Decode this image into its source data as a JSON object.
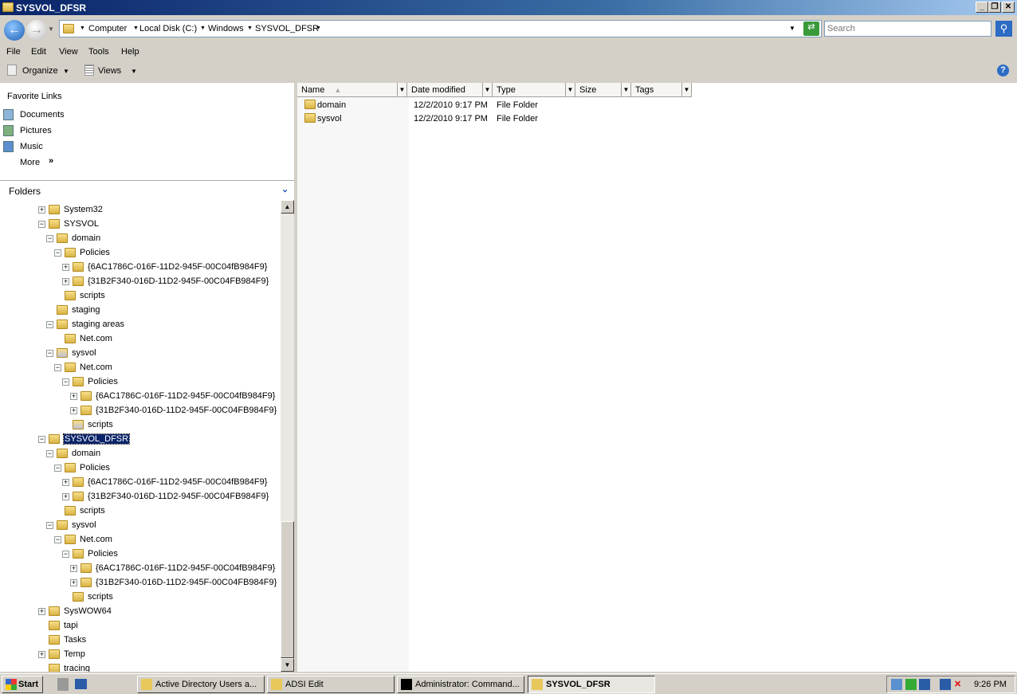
{
  "window": {
    "title": "SYSVOL_DFSR"
  },
  "address": {
    "crumbs": [
      "Computer",
      "Local Disk (C:)",
      "Windows",
      "SYSVOL_DFSR"
    ],
    "search_placeholder": "Search"
  },
  "menu": [
    "File",
    "Edit",
    "View",
    "Tools",
    "Help"
  ],
  "toolbar": {
    "organize": "Organize",
    "views": "Views"
  },
  "favorites": {
    "title": "Favorite Links",
    "items": [
      "Documents",
      "Pictures",
      "Music"
    ],
    "more": "More"
  },
  "folders": {
    "title": "Folders",
    "items": [
      {
        "label": "System32",
        "level": 0,
        "exp": "+"
      },
      {
        "label": "SYSVOL",
        "level": 0,
        "exp": "-"
      },
      {
        "label": "domain",
        "level": 1,
        "exp": "-"
      },
      {
        "label": "Policies",
        "level": 2,
        "exp": "-"
      },
      {
        "label": "{6AC1786C-016F-11D2-945F-00C04fB984F9}",
        "level": 3,
        "exp": "+"
      },
      {
        "label": "{31B2F340-016D-11D2-945F-00C04FB984F9}",
        "level": 3,
        "exp": "+"
      },
      {
        "label": "scripts",
        "level": 2,
        "exp": ""
      },
      {
        "label": "staging",
        "level": 1,
        "exp": ""
      },
      {
        "label": "staging areas",
        "level": 1,
        "exp": "-"
      },
      {
        "label": "Net.com",
        "level": 2,
        "exp": ""
      },
      {
        "label": "sysvol",
        "level": 1,
        "exp": "-",
        "shortcut": true
      },
      {
        "label": "Net.com",
        "level": 2,
        "exp": "-"
      },
      {
        "label": "Policies",
        "level": 3,
        "exp": "-"
      },
      {
        "label": "{6AC1786C-016F-11D2-945F-00C04fB984F9}",
        "level": 4,
        "exp": "+"
      },
      {
        "label": "{31B2F340-016D-11D2-945F-00C04FB984F9}",
        "level": 4,
        "exp": "+"
      },
      {
        "label": "scripts",
        "level": 3,
        "exp": "",
        "shortcut": true
      },
      {
        "label": "SYSVOL_DFSR",
        "level": 0,
        "exp": "-",
        "selected": true
      },
      {
        "label": "domain",
        "level": 1,
        "exp": "-"
      },
      {
        "label": "Policies",
        "level": 2,
        "exp": "-"
      },
      {
        "label": "{6AC1786C-016F-11D2-945F-00C04fB984F9}",
        "level": 3,
        "exp": "+"
      },
      {
        "label": "{31B2F340-016D-11D2-945F-00C04FB984F9}",
        "level": 3,
        "exp": "+"
      },
      {
        "label": "scripts",
        "level": 2,
        "exp": ""
      },
      {
        "label": "sysvol",
        "level": 1,
        "exp": "-"
      },
      {
        "label": "Net.com",
        "level": 2,
        "exp": "-"
      },
      {
        "label": "Policies",
        "level": 3,
        "exp": "-"
      },
      {
        "label": "{6AC1786C-016F-11D2-945F-00C04fB984F9}",
        "level": 4,
        "exp": "+"
      },
      {
        "label": "{31B2F340-016D-11D2-945F-00C04FB984F9}",
        "level": 4,
        "exp": "+"
      },
      {
        "label": "scripts",
        "level": 3,
        "exp": ""
      },
      {
        "label": "SysWOW64",
        "level": 0,
        "exp": "+"
      },
      {
        "label": "tapi",
        "level": 0,
        "exp": ""
      },
      {
        "label": "Tasks",
        "level": 0,
        "exp": ""
      },
      {
        "label": "Temp",
        "level": 0,
        "exp": "+"
      },
      {
        "label": "tracing",
        "level": 0,
        "exp": ""
      }
    ]
  },
  "columns": [
    "Name",
    "Date modified",
    "Type",
    "Size",
    "Tags"
  ],
  "files": [
    {
      "name": "domain",
      "date": "12/2/2010 9:17 PM",
      "type": "File Folder"
    },
    {
      "name": "sysvol",
      "date": "12/2/2010 9:17 PM",
      "type": "File Folder"
    }
  ],
  "taskbar": {
    "start": "Start",
    "tasks": [
      "Active Directory Users a...",
      "ADSI Edit",
      "Administrator: Command...",
      "SYSVOL_DFSR"
    ],
    "clock": "9:26 PM"
  }
}
